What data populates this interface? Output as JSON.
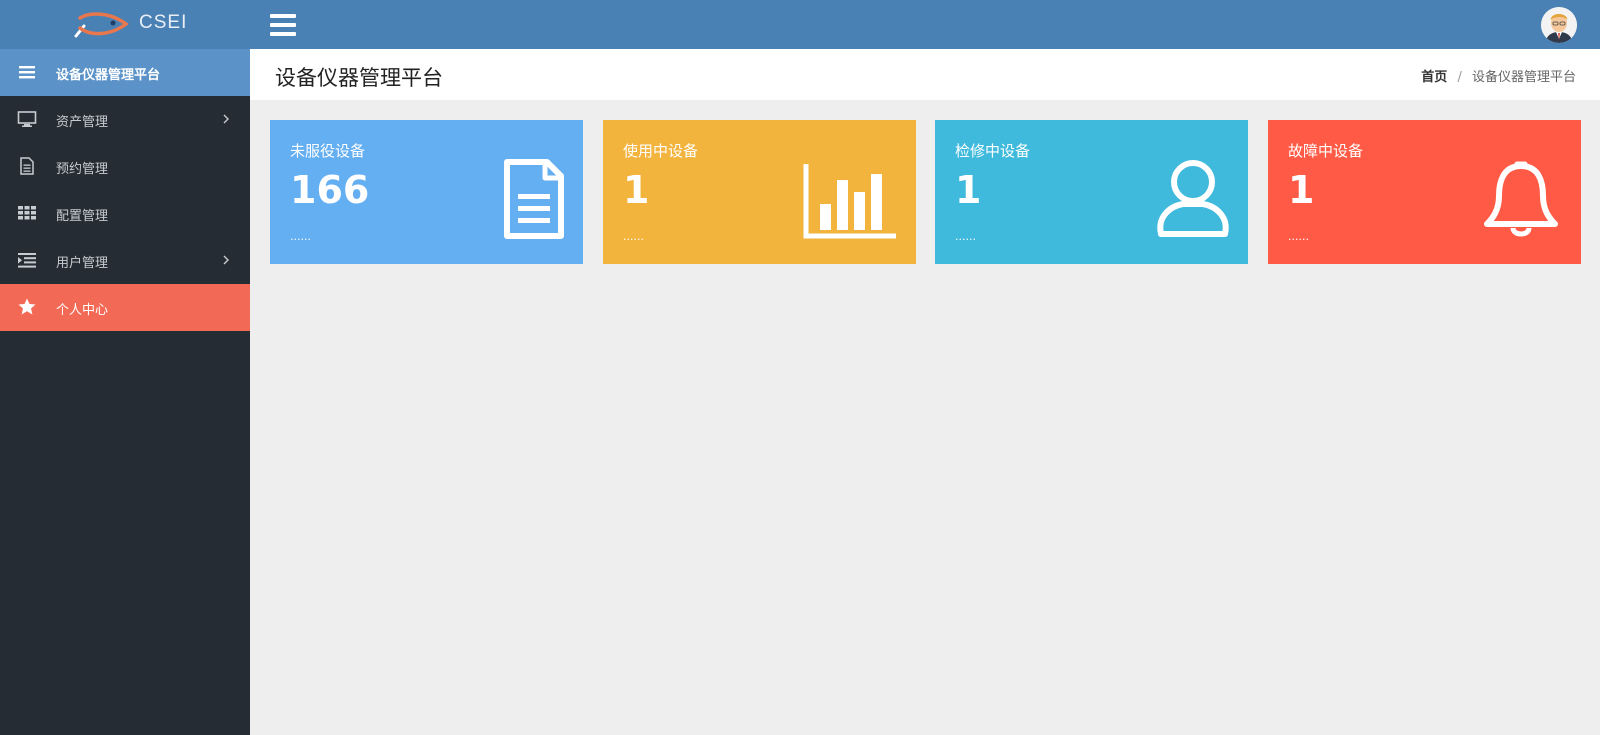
{
  "brand": {
    "name": "CSEI",
    "logo_icon": "fish-logo-icon"
  },
  "header": {
    "menu_icon": "menu-icon",
    "avatar_icon": "user-avatar"
  },
  "sidebar": {
    "items": [
      {
        "label": "设备仪器管理平台",
        "icon": "list-icon",
        "active": true
      },
      {
        "label": "资产管理",
        "icon": "monitor-icon",
        "has_children": true
      },
      {
        "label": "预约管理",
        "icon": "document-icon"
      },
      {
        "label": "配置管理",
        "icon": "grid-icon"
      },
      {
        "label": "用户管理",
        "icon": "indent-list-icon",
        "has_children": true
      },
      {
        "label": "个人中心",
        "icon": "star-icon",
        "highlighted": true
      }
    ]
  },
  "content": {
    "title": "设备仪器管理平台",
    "breadcrumb": {
      "home": "首页",
      "separator": "/",
      "current": "设备仪器管理平台"
    }
  },
  "cards": [
    {
      "title": "未服役设备",
      "value": "166",
      "more": "......",
      "color": "#64aef2",
      "icon": "document-icon"
    },
    {
      "title": "使用中设备",
      "value": "1",
      "more": "......",
      "color": "#f2b43d",
      "icon": "bar-chart-icon"
    },
    {
      "title": "检修中设备",
      "value": "1",
      "more": "......",
      "color": "#3fb9dc",
      "icon": "user-icon"
    },
    {
      "title": "故障中设备",
      "value": "1",
      "more": "......",
      "color": "#ff5a46",
      "icon": "bell-icon"
    }
  ],
  "colors": {
    "topbar": "#4a81b5",
    "sidebar": "#252c34",
    "sidebar_active": "#5b93c8",
    "sidebar_highlight": "#f26a55",
    "background": "#eeeeee"
  }
}
